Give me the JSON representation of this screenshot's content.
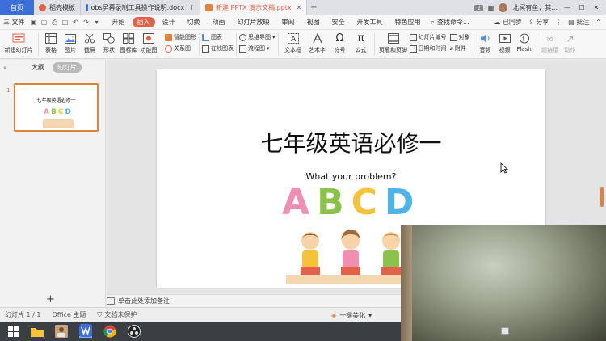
{
  "tabbar": {
    "home": "首页",
    "tabs": [
      {
        "label": "稻壳模板",
        "color": "#e0624a",
        "closable": false,
        "active": false
      },
      {
        "label": "obs屏幕录制工具操作说明.docx",
        "color": "#3c6fd8",
        "closable": true,
        "active": false
      },
      {
        "label": "新建 PPTX 演示文稿.pptx",
        "color": "#e0823a",
        "closable": true,
        "active": true
      }
    ],
    "add": "+",
    "count_badge": "2",
    "user_name": "北冥有鱼，其..."
  },
  "menubar": {
    "file": "三 文件",
    "items": [
      "开始",
      "插入",
      "设计",
      "切换",
      "动画",
      "幻灯片放映",
      "审阅",
      "视图",
      "安全",
      "开发工具",
      "特色应用"
    ],
    "active_index": 1,
    "search": "查找命令...",
    "sync": "已同步",
    "share": "分享",
    "comment": "批注"
  },
  "ribbon": {
    "new_slide": "新建幻灯片",
    "table": "表格",
    "picture": "图片",
    "screenshot": "截屏",
    "shape": "形状",
    "icon_lib": "图标库",
    "function_chart": "功能图",
    "smart_shape": "智能图形",
    "relation": "关系图",
    "chart": "图表",
    "online_chart": "在线图表",
    "mind_map": "思维导图",
    "flow_chart": "流程图",
    "textbox": "文本框",
    "art_text": "艺术字",
    "symbol": "符号",
    "formula": "公式",
    "header_footer": "页眉和页脚",
    "slide_number": "幻灯片编号",
    "object": "对象",
    "date_time": "日期和时间",
    "attachment": "附件",
    "audio": "音频",
    "video": "视频",
    "flash": "Flash",
    "hyperlink": "超链接",
    "action": "动作"
  },
  "leftpanel": {
    "tab_outline": "大纲",
    "tab_slides": "幻灯片",
    "slide_number": "1",
    "thumb_title": "七年级英语必修一",
    "thumb_letters": "ABCD",
    "add_button": "+"
  },
  "slide": {
    "title": "七年级英语必修一",
    "subtitle": "What your problem?",
    "letters": [
      {
        "char": "A",
        "color": "#f08fb0"
      },
      {
        "char": "B",
        "color": "#8bc34a"
      },
      {
        "char": "C",
        "color": "#f5c33b"
      },
      {
        "char": "D",
        "color": "#4fb3e8"
      }
    ]
  },
  "notes": {
    "placeholder": "单击此处添加备注"
  },
  "statusbar": {
    "slide_info": "幻灯片 1 / 1",
    "theme": "Office 主题",
    "protection": "文档未保护",
    "beautify": "一键美化"
  },
  "taskbar": {
    "icons": [
      "windows-start-icon",
      "file-explorer-icon",
      "user-app-icon",
      "wps-icon",
      "chrome-icon",
      "obs-icon"
    ]
  },
  "colors": {
    "accent": "#e0624a",
    "home_tab": "#3c6fd8",
    "selection": "#e0823a"
  }
}
